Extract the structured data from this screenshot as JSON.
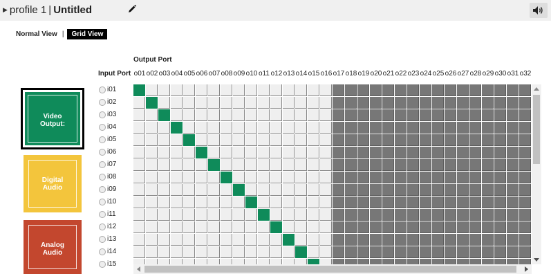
{
  "header": {
    "profile_label": "profile 1",
    "separator": "|",
    "profile_name": "Untitled"
  },
  "view_tabs": {
    "normal": "Normal View",
    "pipe": "|",
    "grid": "Grid View",
    "active": "grid"
  },
  "matrix": {
    "output_title": "Output Port",
    "input_title": "Input Port",
    "outputs": [
      "o01",
      "o02",
      "o03",
      "o04",
      "o05",
      "o06",
      "o07",
      "o08",
      "o09",
      "o10",
      "o11",
      "o12",
      "o13",
      "o14",
      "o15",
      "o16",
      "o17",
      "o18",
      "o19",
      "o20",
      "o21",
      "o22",
      "o23",
      "o24",
      "o25",
      "o26",
      "o27",
      "o28",
      "o29",
      "o30",
      "o31",
      "o32"
    ],
    "inputs": [
      "i01",
      "i02",
      "i03",
      "i04",
      "i05",
      "i06",
      "i07",
      "i08",
      "i09",
      "i10",
      "i11",
      "i12",
      "i13",
      "i14",
      "i15"
    ],
    "active_output_count": 16,
    "routes": [
      [
        1,
        1
      ],
      [
        2,
        2
      ],
      [
        3,
        3
      ],
      [
        4,
        4
      ],
      [
        5,
        5
      ],
      [
        6,
        6
      ],
      [
        7,
        7
      ],
      [
        8,
        8
      ],
      [
        9,
        9
      ],
      [
        10,
        10
      ],
      [
        11,
        11
      ],
      [
        12,
        12
      ],
      [
        13,
        13
      ],
      [
        14,
        14
      ],
      [
        15,
        15
      ]
    ],
    "colors": {
      "route": "#0f8b5a",
      "active_cell": "#efefef",
      "disabled_cell": "#777777"
    }
  },
  "signals": {
    "video": {
      "label_line1": "Video",
      "label_line2": "Output:",
      "color": "#0f8b5a"
    },
    "digital": {
      "label_line1": "Digital",
      "label_line2": "Audio",
      "color": "#f3c53c"
    },
    "analog": {
      "label_line1": "Analog",
      "label_line2": "Audio",
      "color": "#c3472e"
    }
  },
  "icons": {
    "header_arrow": "triangle-right",
    "edit": "pencil-icon",
    "audio": "speaker-icon"
  }
}
